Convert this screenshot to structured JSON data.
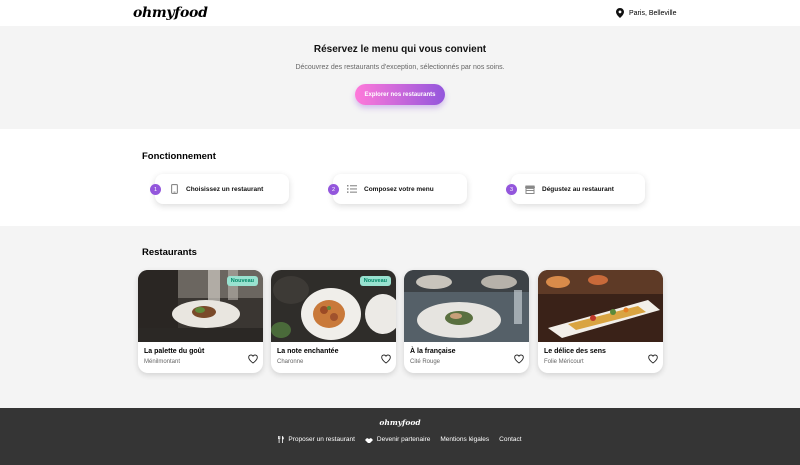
{
  "header": {
    "logo": "ohmyfood",
    "location": "Paris, Belleville",
    "location_icon": "map-pin-icon"
  },
  "hero": {
    "title": "Réservez le menu qui vous convient",
    "subtitle": "Découvrez des restaurants d'exception, sélectionnés par nos soins.",
    "button_label": "Explorer nos restaurants"
  },
  "how": {
    "title": "Fonctionnement",
    "steps": [
      {
        "number": "1",
        "label": "Choisissez un restaurant",
        "icon": "mobile-phone-icon"
      },
      {
        "number": "2",
        "label": "Composez votre menu",
        "icon": "list-icon"
      },
      {
        "number": "3",
        "label": "Dégustez au restaurant",
        "icon": "store-icon"
      }
    ]
  },
  "restaurants": {
    "title": "Restaurants",
    "badge_label": "Nouveau",
    "items": [
      {
        "name": "La palette du goût",
        "area": "Ménilmontant",
        "new": true
      },
      {
        "name": "La note enchantée",
        "area": "Charonne",
        "new": true
      },
      {
        "name": "À la française",
        "area": "Cité Rouge",
        "new": false
      },
      {
        "name": "Le délice des sens",
        "area": "Folie Méricourt",
        "new": false
      }
    ]
  },
  "footer": {
    "logo": "ohmyfood",
    "links": [
      {
        "label": "Proposer un restaurant",
        "icon": "utensils-icon"
      },
      {
        "label": "Devenir partenaire",
        "icon": "handshake-icon"
      },
      {
        "label": "Mentions légales",
        "icon": ""
      },
      {
        "label": "Contact",
        "icon": ""
      }
    ]
  },
  "colors": {
    "primary": "#9356dc",
    "secondary": "#ff79da",
    "badge_bg": "#99e2d0",
    "badge_text": "#008766",
    "footer_bg": "#353535"
  }
}
